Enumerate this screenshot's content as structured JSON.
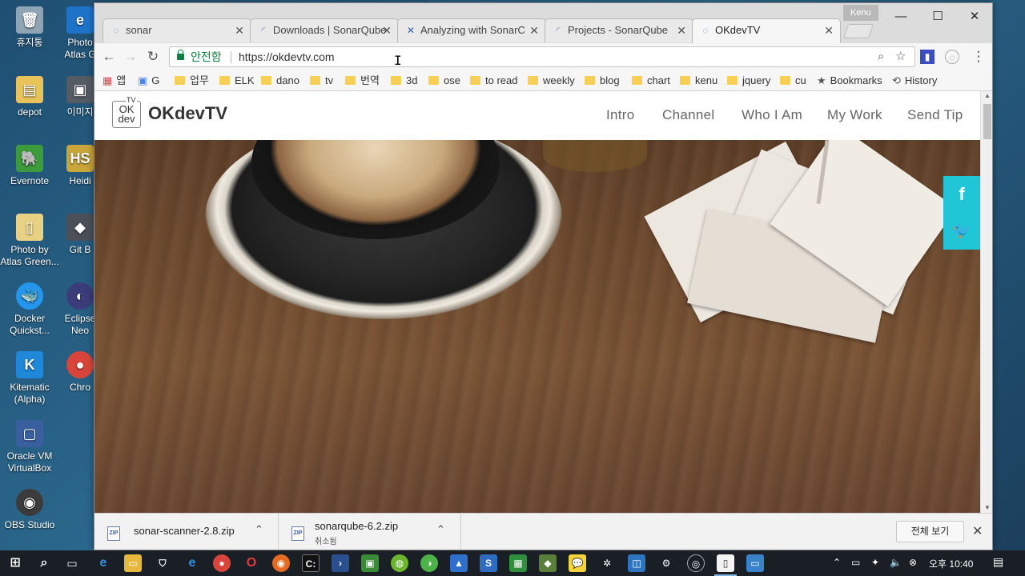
{
  "desktop": {
    "icons": [
      {
        "label": "휴지통",
        "icon": "recycle-bin-icon",
        "color": "#8fa5b6"
      },
      {
        "label": "Photo\nAtlas G",
        "icon": "edge-icon",
        "color": "#1e73c9"
      },
      {
        "label": "depot",
        "icon": "folder-icon",
        "color": "#e8c35a"
      },
      {
        "label": "이미지",
        "icon": "image-app-icon",
        "color": "#555b63"
      },
      {
        "label": "Evernote",
        "icon": "evernote-icon",
        "color": "#3c9b3a"
      },
      {
        "label": "Heidi",
        "icon": "heidisql-icon",
        "color": "#c9a53a"
      },
      {
        "label": "Photo by\nAtlas Green...",
        "icon": "file-icon",
        "color": "#e9d183"
      },
      {
        "label": "Git B",
        "icon": "git-bash-icon",
        "color": "#4a4f58"
      },
      {
        "label": "Docker\nQuickst...",
        "icon": "docker-icon",
        "color": "#2496ed"
      },
      {
        "label": "Eclipse\nNeo",
        "icon": "eclipse-icon",
        "color": "#3b3d7a"
      },
      {
        "label": "Kitematic\n(Alpha)",
        "icon": "kitematic-icon",
        "color": "#1f88d8"
      },
      {
        "label": "Chro",
        "icon": "chrome-icon",
        "color": "#d9453a"
      },
      {
        "label": "Oracle VM\nVirtualBox",
        "icon": "virtualbox-icon",
        "color": "#3a5f9f"
      },
      {
        "label": "OBS Studio",
        "icon": "obs-icon",
        "color": "#3b3b3b"
      }
    ]
  },
  "browser": {
    "profile_name": "Kenu",
    "tabs": [
      {
        "title": "sonar",
        "icon": "globe-icon",
        "active": false
      },
      {
        "title": "Downloads | SonarQube",
        "icon": "sonarqube-icon",
        "active": false
      },
      {
        "title": "Analyzing with SonarC",
        "icon": "confluence-icon",
        "active": false
      },
      {
        "title": "Projects - SonarQube",
        "icon": "sonarqube-icon",
        "active": false
      },
      {
        "title": "OKdevTV",
        "icon": "globe-icon",
        "active": true
      }
    ],
    "window_buttons": {
      "minimize": "—",
      "maximize": "☐",
      "close": "✕"
    },
    "toolbar": {
      "back": "←",
      "forward": "→",
      "reload": "↻",
      "secure_label": "안전함",
      "url": "https://okdevtv.com",
      "zoom_icon": "⌕",
      "star_icon": "☆",
      "menu_icon": "⋮"
    },
    "bookmarks": [
      {
        "label": "앱",
        "kind": "apps"
      },
      {
        "label": "G",
        "kind": "translate"
      },
      {
        "label": "업무",
        "kind": "folder"
      },
      {
        "label": "ELK",
        "kind": "folder"
      },
      {
        "label": "dano",
        "kind": "folder"
      },
      {
        "label": "tv",
        "kind": "folder"
      },
      {
        "label": "번역",
        "kind": "folder"
      },
      {
        "label": "3d",
        "kind": "folder"
      },
      {
        "label": "ose",
        "kind": "folder"
      },
      {
        "label": "to read",
        "kind": "folder"
      },
      {
        "label": "weekly",
        "kind": "folder"
      },
      {
        "label": "blog",
        "kind": "folder"
      },
      {
        "label": "chart",
        "kind": "folder"
      },
      {
        "label": "kenu",
        "kind": "folder"
      },
      {
        "label": "jquery",
        "kind": "folder"
      },
      {
        "label": "cu",
        "kind": "folder"
      },
      {
        "label": "Bookmarks",
        "kind": "star"
      },
      {
        "label": "History",
        "kind": "history"
      }
    ]
  },
  "site": {
    "logo_top": "TV",
    "logo_line1": "OK",
    "logo_line2": "dev",
    "title": "OKdevTV",
    "nav": [
      "Intro",
      "Channel",
      "Who I Am",
      "My Work",
      "Send Tip"
    ],
    "social": {
      "facebook": "f",
      "twitter": "🐦"
    },
    "accent": "#20c6d6"
  },
  "downloads": {
    "items": [
      {
        "name": "sonar-scanner-2.8.zip",
        "status": "",
        "icon_text": "ZIP"
      },
      {
        "name": "sonarqube-6.2.zip",
        "status": "취소됨",
        "icon_text": "ZIP"
      }
    ],
    "show_all": "전체 보기",
    "close": "✕"
  },
  "taskbar": {
    "clock": "오후 10:40",
    "apps": [
      "start-icon",
      "search-icon",
      "task-view-icon",
      "edge-icon",
      "file-explorer-icon",
      "store-icon",
      "ie-icon",
      "chrome-icon",
      "opera-icon",
      "firefox-icon",
      "cmd-icon",
      "powershell-icon",
      "app-green-icon",
      "app-multicolor-icon",
      "app-sublime-icon",
      "app-blue-icon",
      "app-s-icon",
      "app-green2-icon",
      "app-diamond-icon",
      "kakaotalk-icon",
      "app-gear-icon",
      "app-box-icon",
      "settings-icon",
      "obs-icon",
      "notepad-icon",
      "remote-icon"
    ]
  }
}
